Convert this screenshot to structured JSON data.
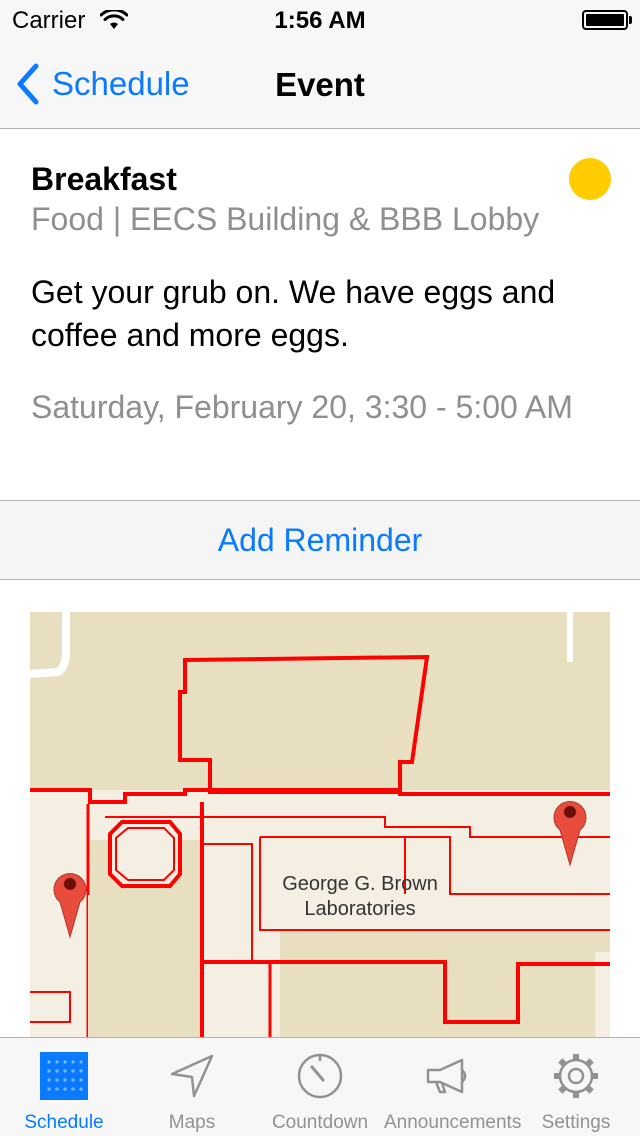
{
  "status_bar": {
    "carrier": "Carrier",
    "time": "1:56 AM",
    "wifi_icon": "wifi-icon",
    "battery_icon": "battery-icon"
  },
  "nav": {
    "back_label": "Schedule",
    "title": "Event"
  },
  "event": {
    "title": "Breakfast",
    "subtitle": "Food | EECS Building & BBB Lobby",
    "description": "Get your grub on. We have eggs and coffee and more eggs.",
    "time": "Saturday, February 20, 3:30 - 5:00 AM",
    "status_color": "#ffcc00"
  },
  "reminder": {
    "label": "Add Reminder"
  },
  "map": {
    "building_label": "George G. Brown Laboratories",
    "pin_color": "#e74c3c",
    "outline_color": "#ff0000"
  },
  "tabs": [
    {
      "label": "Schedule",
      "icon": "calendar-grid-icon",
      "active": true
    },
    {
      "label": "Maps",
      "icon": "location-arrow-icon",
      "active": false
    },
    {
      "label": "Countdown",
      "icon": "countdown-dial-icon",
      "active": false
    },
    {
      "label": "Announcements",
      "icon": "megaphone-icon",
      "active": false
    },
    {
      "label": "Settings",
      "icon": "gear-icon",
      "active": false
    }
  ],
  "colors": {
    "accent": "#0a7aff",
    "secondary_text": "#8e8e93"
  }
}
